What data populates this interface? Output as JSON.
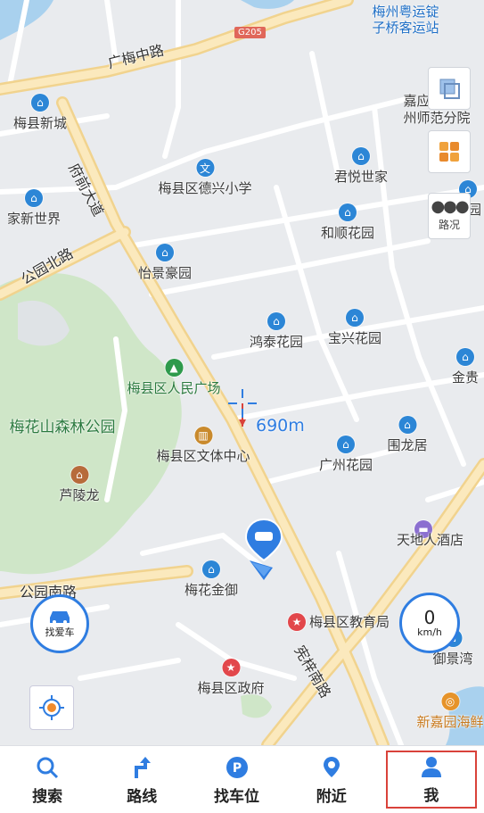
{
  "map": {
    "roads": [
      {
        "id": "guangmei",
        "label": "广梅中路",
        "shield": "G205"
      },
      {
        "id": "fuqian",
        "label": "府前大道"
      },
      {
        "id": "gongyuan_n",
        "label": "公园北路"
      },
      {
        "id": "gongyuan_s",
        "label": "公园南路"
      },
      {
        "id": "xianren",
        "label": "宪梓南路"
      }
    ],
    "pois": [
      {
        "name": "梅州粤运锭子桥客运站",
        "line2": "子桥客运站",
        "line1": "梅州粤运锭",
        "color": "#2c86d6"
      },
      {
        "name": "梅县新城",
        "color": "#2c86d6"
      },
      {
        "name": "嘉应学院梅州师范分院",
        "line1": "嘉应学院梅",
        "line2": "州师范分院",
        "color": "#2c86d6"
      },
      {
        "name": "梅县区德兴小学",
        "color": "#2c86d6"
      },
      {
        "name": "君悦世家",
        "color": "#2c86d6"
      },
      {
        "name": "家新世界",
        "color": "#2c86d6"
      },
      {
        "name": "和顺花园",
        "color": "#2c86d6"
      },
      {
        "name": "豪园",
        "color": "#2c86d6"
      },
      {
        "name": "怡景豪园",
        "color": "#2c86d6"
      },
      {
        "name": "鸿泰花园",
        "color": "#2c86d6"
      },
      {
        "name": "宝兴花园",
        "color": "#2c86d6"
      },
      {
        "name": "金贵",
        "color": "#2c86d6"
      },
      {
        "name": "梅县区人民广场",
        "color": "#2e9a4c"
      },
      {
        "name": "梅花山森林公园",
        "color": "#2e9a4c"
      },
      {
        "name": "梅县区文体中心",
        "color": "#c98a2d"
      },
      {
        "name": "广州花园",
        "color": "#2c86d6"
      },
      {
        "name": "围龙居",
        "color": "#2c86d6"
      },
      {
        "name": "芦陵龙",
        "color": "#b76b3b"
      },
      {
        "name": "天地人酒店",
        "color": "#8b6fd0"
      },
      {
        "name": "梅花金御",
        "color": "#2c86d6"
      },
      {
        "name": "梅县区教育局",
        "color": "#e2474b"
      },
      {
        "name": "御景湾",
        "color": "#2c86d6"
      },
      {
        "name": "梅县区政府",
        "color": "#e2474b"
      },
      {
        "name": "新嘉园海鲜",
        "color": "#e6932a"
      }
    ],
    "distance_label": "690m"
  },
  "controls": {
    "layers_icon": "layers-icon",
    "apps_icon": "apps-icon",
    "traffic_label": "路况",
    "findcar_label": "找爱车",
    "speed_value": "0",
    "speed_unit": "km/h"
  },
  "tabs": [
    {
      "label": "搜索",
      "icon": "search-icon"
    },
    {
      "label": "路线",
      "icon": "route-icon"
    },
    {
      "label": "找车位",
      "icon": "parking-icon"
    },
    {
      "label": "附近",
      "icon": "location-pin-icon"
    },
    {
      "label": "我",
      "icon": "user-icon",
      "selected": true
    }
  ],
  "colors": {
    "accent": "#2f7de1",
    "highlight": "#d9423a",
    "main_road": "#f5dfa2"
  }
}
